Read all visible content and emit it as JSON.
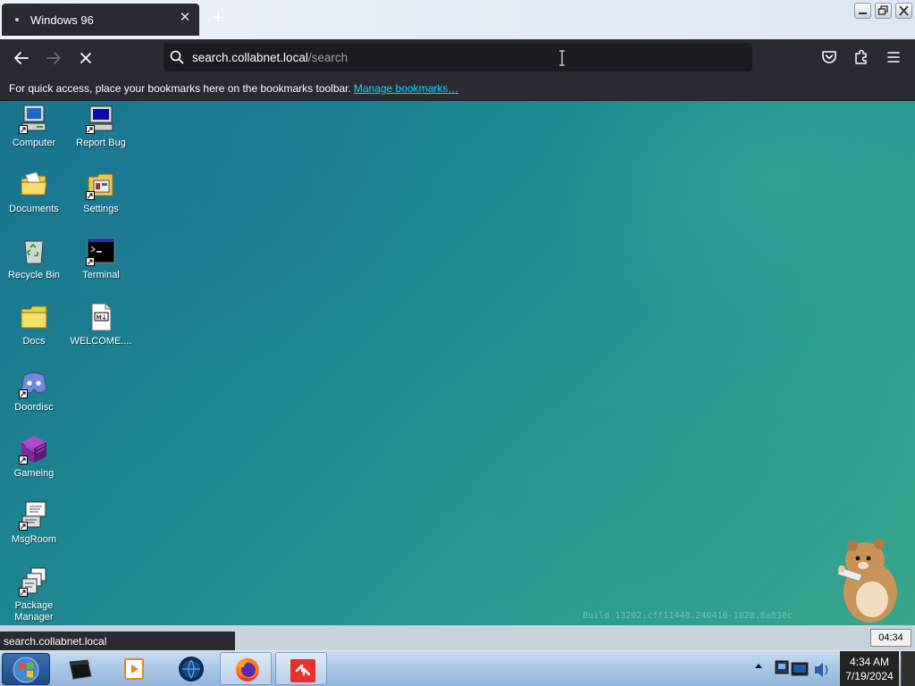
{
  "browser": {
    "tab_title": "Windows 96",
    "tab_close": "✕",
    "new_tab": "+",
    "url_host": "search.collabnet.local",
    "url_path": "/search",
    "bookmarks_message": "For quick access, place your bookmarks here on the bookmarks toolbar.",
    "bookmarks_link": "Manage bookmarks…",
    "status_url": "search.collabnet.local"
  },
  "desktop": {
    "icons": [
      {
        "label": "Computer",
        "icon": "computer-icon"
      },
      {
        "label": "Report Bug",
        "icon": "report-bug-icon"
      },
      {
        "label": "Documents",
        "icon": "documents-folder-icon"
      },
      {
        "label": "Settings",
        "icon": "settings-icon"
      },
      {
        "label": "Recycle Bin",
        "icon": "recycle-bin-icon"
      },
      {
        "label": "Terminal",
        "icon": "terminal-icon"
      },
      {
        "label": "Docs",
        "icon": "docs-folder-icon"
      },
      {
        "label": "WELCOME....",
        "icon": "markdown-file-icon"
      },
      {
        "label": "Doordisc",
        "icon": "doordisc-icon"
      },
      {
        "label": "Gameing",
        "icon": "gameing-icon"
      },
      {
        "label": "MsgRoom",
        "icon": "msgroom-icon"
      },
      {
        "label": "Package Manager",
        "icon": "package-manager-icon"
      }
    ],
    "build_info": "Build 13202.cff11448.240410-1828.8a830c",
    "mini_clock": "04:34"
  },
  "taskbar": {
    "apps": [
      "media-box-icon",
      "media-player-icon",
      "globe-browser-icon",
      "firefox-icon",
      "bittorrent-icon"
    ],
    "clock_time": "4:34 AM",
    "clock_date": "7/19/2024"
  }
}
